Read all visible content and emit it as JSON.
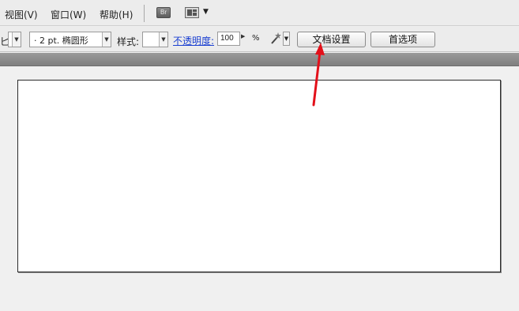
{
  "menubar": {
    "items": [
      {
        "label": "视图(V)"
      },
      {
        "label": "窗口(W)"
      },
      {
        "label": "帮助(H)"
      }
    ],
    "bridge_label": "Br",
    "layout_icon": "workspace-layout-icon"
  },
  "controlbar": {
    "cut_prefix": "匕",
    "stroke_profile": "·  2 pt. 椭圆形",
    "style_label": "样式:",
    "style_value": "",
    "opacity_label": "不透明度:",
    "opacity_value": "100",
    "percent_label": "%",
    "wand_icon": "magic-wand-icon",
    "doc_setup_label": "文档设置",
    "preferences_label": "首选项"
  },
  "annotation": {
    "arrow_color": "#e3101a"
  }
}
